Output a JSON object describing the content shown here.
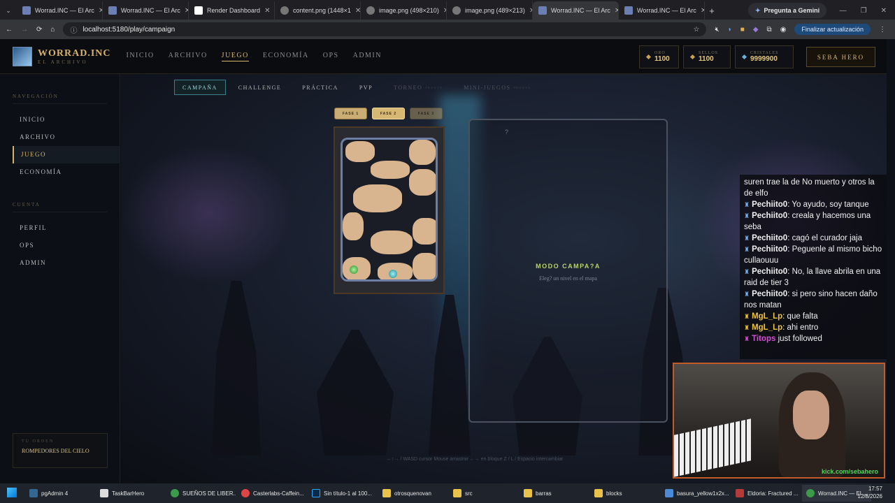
{
  "browser": {
    "tabs": [
      "Worrad.INC — El Arc",
      "Worrad.INC — El Arc",
      "Render Dashboard",
      "content.png (1448×1",
      "image.png (498×210)",
      "image.png (489×213)",
      "Worrad.INC — El Arc",
      "Worrad.INC — El Arc"
    ],
    "gemini": "Pregunta a Gemini",
    "url": "localhost:5180/play/campaign",
    "update": "Finalizar actualización"
  },
  "nav": {
    "brand": "WORRAD.INC",
    "subtitle": "EL ARCHIVO",
    "menu": [
      "INICIO",
      "ARCHIVO",
      "JUEGO",
      "ECONOMÍA",
      "OPS",
      "ADMIN"
    ],
    "oro_label": "ORO",
    "oro": "1100",
    "sellos_label": "SELLOS",
    "sellos": "1100",
    "cristales_label": "CRISTALES",
    "cristales": "9999900",
    "hero": "SEBA HERO"
  },
  "sidebar": {
    "nav_title": "NAVEGACIÓN",
    "nav_items": [
      "INICIO",
      "ARCHIVO",
      "JUEGO",
      "ECONOMÍA"
    ],
    "account_title": "CUENTA",
    "account_items": [
      "PERFIL",
      "OPS",
      "ADMIN"
    ],
    "guild_label": "TU ORDEN",
    "guild": "ROMPEDORES DEL CIELO"
  },
  "modes": [
    {
      "label": "CAMPAÑA",
      "tag": ""
    },
    {
      "label": "CHALLENGE",
      "tag": ""
    },
    {
      "label": "PRÁCTICA",
      "tag": ""
    },
    {
      "label": "PVP",
      "tag": ""
    },
    {
      "label": "TORNEO",
      "tag": "PRONTO"
    },
    {
      "label": "MINI-JUEGOS",
      "tag": "PRONTO"
    }
  ],
  "phases": [
    "FASE 1",
    "FASE 2",
    "FASE 3"
  ],
  "panel": {
    "q": "?",
    "title": "MODO CAMPA?A",
    "subtitle": "Eleg? un nivel en el mapa"
  },
  "hint": "←↑→ / WASD cursor   Mouse arrastrar ←→ en bloque   Z / L / Espacio intercambiar",
  "chat": [
    {
      "user": "",
      "text": "suren trae la de No muerto y otros la de elfo",
      "color": "#ffffff"
    },
    {
      "user": "Pechiito0",
      "text": ": Yo ayudo, soy tanque",
      "color": "#ffffff"
    },
    {
      "user": "Pechiito0",
      "text": ": creala y hacemos una seba",
      "color": "#ffffff"
    },
    {
      "user": "Pechiito0",
      "text": ": cagó el curador jaja",
      "color": "#ffffff"
    },
    {
      "user": "Pechiito0",
      "text": ": Peguenle al mismo bicho cullaouuu",
      "color": "#ffffff"
    },
    {
      "user": "Pechiito0",
      "text": ": No, la llave abrila en una raid de tier 3",
      "color": "#ffffff"
    },
    {
      "user": "Pechiito0",
      "text": ": si pero sino hacen daño nos matan",
      "color": "#ffffff"
    },
    {
      "user": "MgL_Lp",
      "text": ": que falta",
      "color": "#f0c23a"
    },
    {
      "user": "MgL_Lp",
      "text": ": ahi entro",
      "color": "#f0c23a"
    },
    {
      "user": "Titops",
      "text": " just followed",
      "color": "#d64bd6"
    }
  ],
  "kick": "kick.com/sebahero",
  "taskbar": [
    "pgAdmin 4",
    "TaskBarHero",
    "SUEÑOS DE LIBER...",
    "Casterlabs-Caffein...",
    "Sin título-1 al 100...",
    "otrosquenovan",
    "src",
    "barras",
    "blocks",
    "basura_yellow1x2x...",
    "Eldoria: Fractured ...",
    "Worrad.INC — El ..."
  ],
  "clock": {
    "time": "17:57",
    "date": "12/8/2026"
  }
}
